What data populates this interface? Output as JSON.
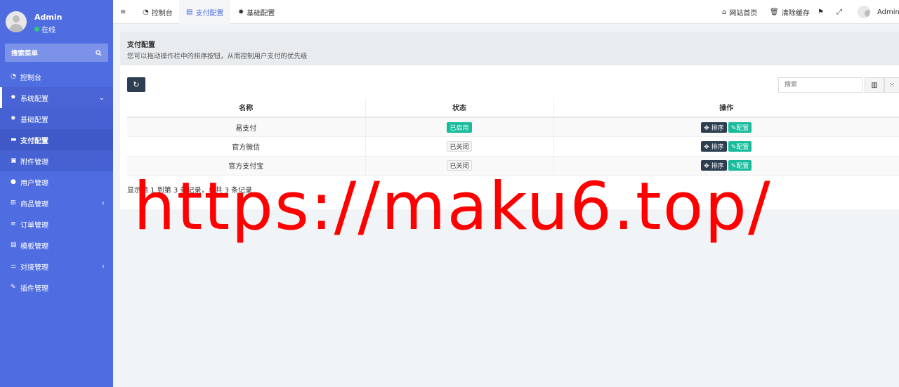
{
  "sidebar": {
    "user_name": "Admin",
    "user_status": "在线",
    "search_label": "搜索菜单",
    "items": [
      {
        "label": "控制台",
        "icon": "dashboard-icon"
      },
      {
        "label": "系统配置",
        "icon": "gear-icon"
      },
      {
        "label": "基础配置",
        "icon": "gear-icon"
      },
      {
        "label": "支付配置",
        "icon": "card-icon"
      },
      {
        "label": "附件管理",
        "icon": "file-icon"
      },
      {
        "label": "用户管理",
        "icon": "user-icon"
      },
      {
        "label": "商品管理",
        "icon": "cart-icon"
      },
      {
        "label": "订单管理",
        "icon": "list-icon"
      },
      {
        "label": "模板管理",
        "icon": "template-icon"
      },
      {
        "label": "对接管理",
        "icon": "sliders-icon"
      },
      {
        "label": "插件管理",
        "icon": "plug-icon"
      }
    ]
  },
  "topbar": {
    "tabs": [
      {
        "label": "控制台"
      },
      {
        "label": "支付配置"
      },
      {
        "label": "基础配置"
      }
    ],
    "home_label": "网站首页",
    "clear_cache_label": "清除缓存",
    "admin_label": "Admin"
  },
  "header": {
    "title": "支付配置",
    "description": "您可以拖动操作栏中的排序按钮，从而控制用户支付的优先级"
  },
  "toolbar": {
    "search_placeholder": "搜索"
  },
  "table": {
    "columns": [
      "名称",
      "状态",
      "操作"
    ],
    "rows": [
      {
        "name": "易支付",
        "status": "已启用",
        "enabled": true
      },
      {
        "name": "官方微信",
        "status": "已关闭",
        "enabled": false
      },
      {
        "name": "官方支付宝",
        "status": "已关闭",
        "enabled": false
      }
    ],
    "sort_label": "排序",
    "config_label": "配置"
  },
  "pager": {
    "text": "显示第 1 到第 3 条记录，总共 3 条记录"
  },
  "watermark": "https://maku6.top/",
  "colors": {
    "sidebar": "#4f6de0",
    "accent": "#18bc9c",
    "dark_button": "#2c3e50",
    "watermark": "#ff0000"
  }
}
